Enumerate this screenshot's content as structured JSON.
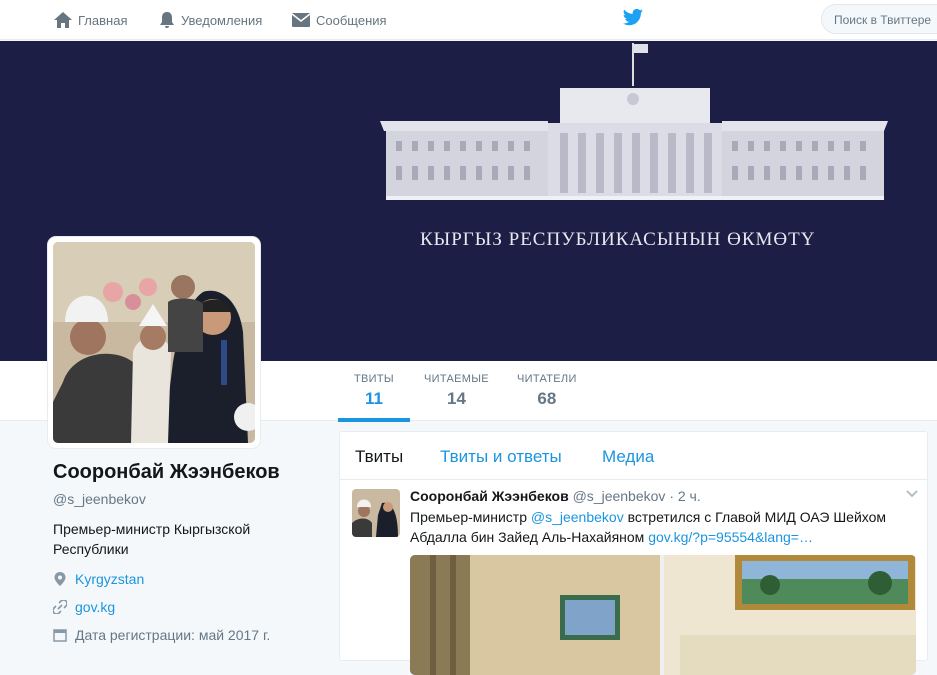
{
  "nav": {
    "home": "Главная",
    "notifications": "Уведомления",
    "messages": "Сообщения",
    "search_placeholder": "Поиск в Твиттере"
  },
  "banner": {
    "caption": "КЫРГЫЗ РЕСПУБЛИКАСЫНЫН ӨКМӨТҮ",
    "background_color": "#1d1e45"
  },
  "stats": [
    {
      "label": "ТВИТЫ",
      "value": "11"
    },
    {
      "label": "ЧИТАЕМЫЕ",
      "value": "14"
    },
    {
      "label": "ЧИТАТЕЛИ",
      "value": "68"
    }
  ],
  "profile": {
    "name": "Сооронбай Жээнбеков",
    "handle": "@s_jeenbekov",
    "bio": "Премьер-министр Кыргызской Республики",
    "location": "Kyrgyzstan",
    "url": "gov.kg",
    "joined": "Дата регистрации: май 2017 г."
  },
  "timeline": {
    "tabs": [
      "Твиты",
      "Твиты и ответы",
      "Медиа"
    ],
    "tweet": {
      "name": "Сооронбай Жээнбеков",
      "handle": "@s_jeenbekov",
      "sep": "·",
      "time": "2 ч.",
      "text_before": "Премьер-министр ",
      "mention": "@s_jeenbekov",
      "text_after": " встретился с Главой МИД ОАЭ Шейхом Абдалла бин Зайед Аль-Нахайяном ",
      "link": "gov.kg/?p=95554&lang=…"
    }
  },
  "colors": {
    "accent": "#1b95e0",
    "twitter_blue": "#1da1f2"
  }
}
